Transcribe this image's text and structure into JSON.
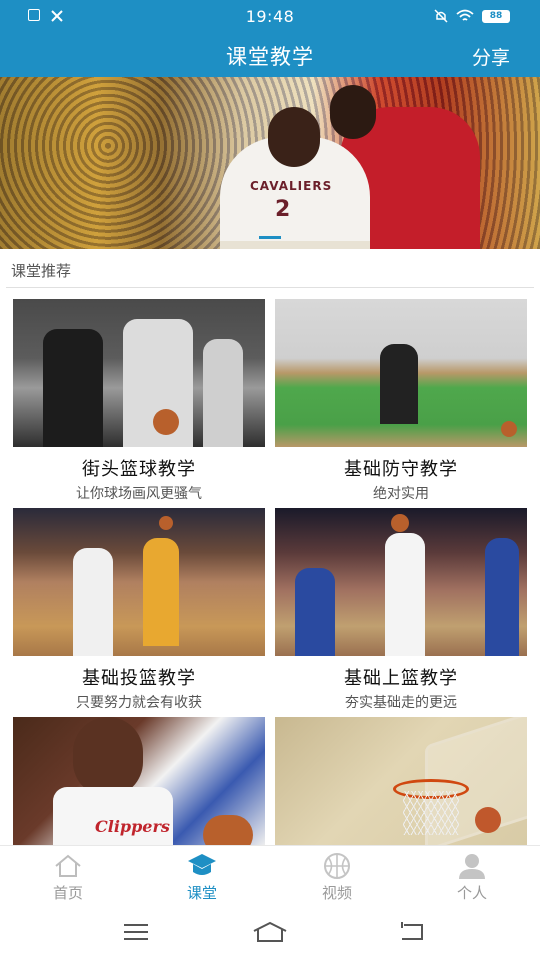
{
  "status_bar": {
    "time": "19:48",
    "battery": "88"
  },
  "header": {
    "title": "课堂教学",
    "share_label": "分享"
  },
  "banner": {
    "jersey_text": "CAVALIERS",
    "jersey_number": "2",
    "active_index": 0
  },
  "section": {
    "title": "课堂推荐"
  },
  "courses": [
    {
      "title": "街头篮球教学",
      "subtitle": "让你球场画风更骚气"
    },
    {
      "title": "基础防守教学",
      "subtitle": "绝对实用"
    },
    {
      "title": "基础投篮教学",
      "subtitle": "只要努力就会有收获"
    },
    {
      "title": "基础上篮教学",
      "subtitle": "夯实基础走的更远"
    },
    {
      "title": "",
      "subtitle": ""
    },
    {
      "title": "",
      "subtitle": ""
    }
  ],
  "jersey2_text": "Clippers",
  "bottom_nav": [
    {
      "label": "首页",
      "icon": "home-icon",
      "active": false
    },
    {
      "label": "课堂",
      "icon": "classroom-icon",
      "active": true
    },
    {
      "label": "视频",
      "icon": "basketball-icon",
      "active": false
    },
    {
      "label": "个人",
      "icon": "person-icon",
      "active": false
    }
  ],
  "colors": {
    "accent": "#1e8fc4",
    "inactive": "#9a9a9a"
  }
}
